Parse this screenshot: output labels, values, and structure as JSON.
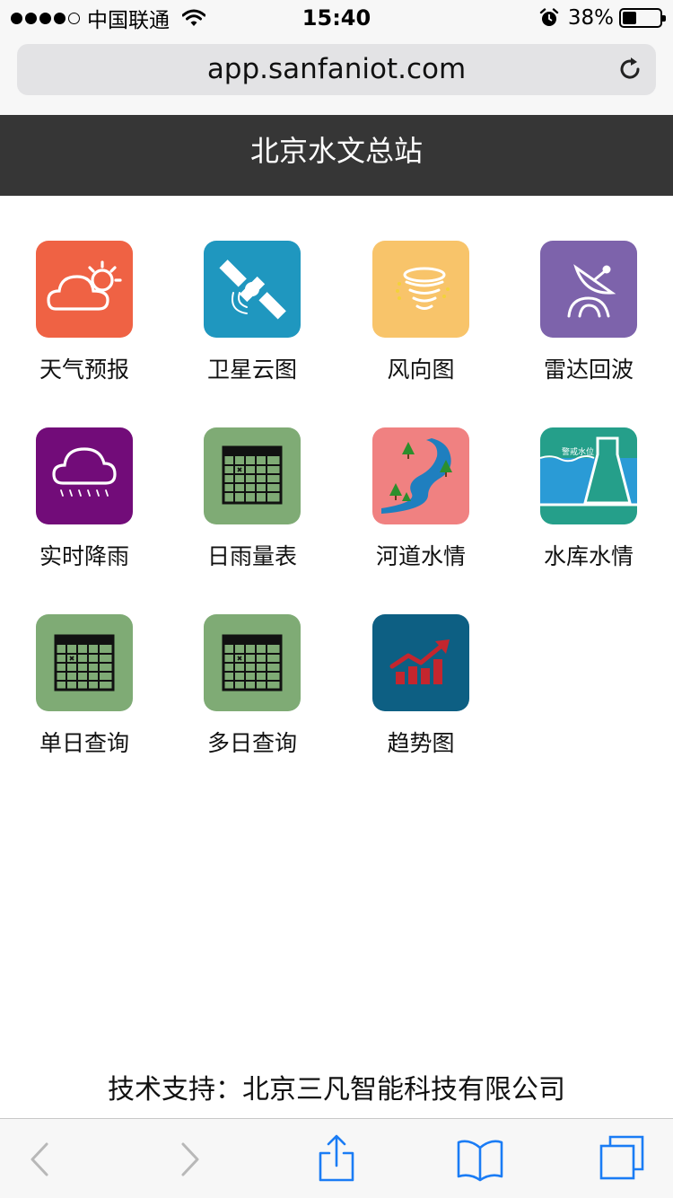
{
  "status_bar": {
    "carrier": "中国联通",
    "time": "15:40",
    "battery": "38%",
    "battery_level": 0.38
  },
  "browser": {
    "url": "app.sanfaniot.com"
  },
  "header": {
    "title": "北京水文总站"
  },
  "menu": {
    "items": [
      {
        "label": "天气预报",
        "icon": "weather-forecast-icon",
        "color": "#ef6244"
      },
      {
        "label": "卫星云图",
        "icon": "satellite-icon",
        "color": "#1f97bf"
      },
      {
        "label": "风向图",
        "icon": "tornado-icon",
        "color": "#f8c46a"
      },
      {
        "label": "雷达回波",
        "icon": "radar-dish-icon",
        "color": "#7d63ab"
      },
      {
        "label": "实时降雨",
        "icon": "rain-cloud-icon",
        "color": "#720c79"
      },
      {
        "label": "日雨量表",
        "icon": "calendar-table-icon",
        "color": "#7fab75"
      },
      {
        "label": "河道水情",
        "icon": "river-icon",
        "color": "#f08181"
      },
      {
        "label": "水库水情",
        "icon": "reservoir-icon",
        "color": "#259f8a"
      },
      {
        "label": "单日查询",
        "icon": "calendar-table-icon",
        "color": "#7fab75"
      },
      {
        "label": "多日查询",
        "icon": "calendar-table-icon",
        "color": "#7fab75"
      },
      {
        "label": "趋势图",
        "icon": "trend-chart-icon",
        "color": "#0d5f83"
      }
    ],
    "reservoir_sign": "警戒水位"
  },
  "footer": {
    "text": "技术支持：北京三凡智能科技有限公司"
  },
  "colors": {
    "header_bg": "#363636",
    "toolbar_blue": "#1a7cf5",
    "toolbar_disabled": "#b8b8b8"
  }
}
